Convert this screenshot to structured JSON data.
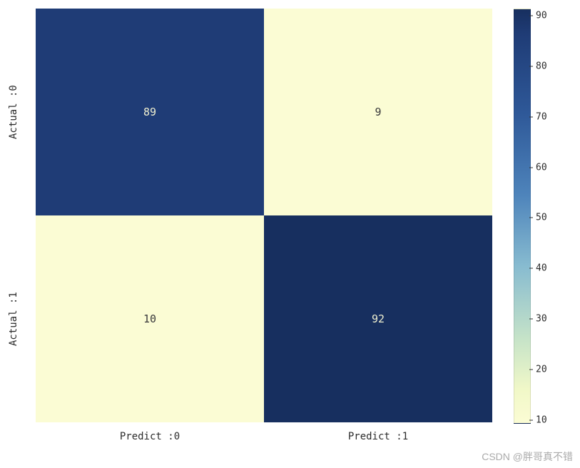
{
  "chart_data": {
    "type": "heatmap",
    "x_labels": [
      "Predict :0",
      "Predict :1"
    ],
    "y_labels": [
      "Actual :0",
      "Actual :1"
    ],
    "values": [
      [
        89,
        9
      ],
      [
        10,
        92
      ]
    ],
    "colorbar": {
      "range": [
        9,
        92
      ],
      "ticks": [
        90,
        80,
        70,
        60,
        50,
        40,
        30,
        20,
        10
      ]
    }
  },
  "cells": {
    "r0c0": "89",
    "r0c1": "9",
    "r1c0": "10",
    "r1c1": "92"
  },
  "ylabels": {
    "row0": "Actual :0",
    "row1": "Actual :1"
  },
  "xlabels": {
    "col0": "Predict :0",
    "col1": "Predict :1"
  },
  "cbar": {
    "t90": "90",
    "t80": "80",
    "t70": "70",
    "t60": "60",
    "t50": "50",
    "t40": "40",
    "t30": "30",
    "t20": "20",
    "t10": "10"
  },
  "watermark": "CSDN @胖哥真不错"
}
